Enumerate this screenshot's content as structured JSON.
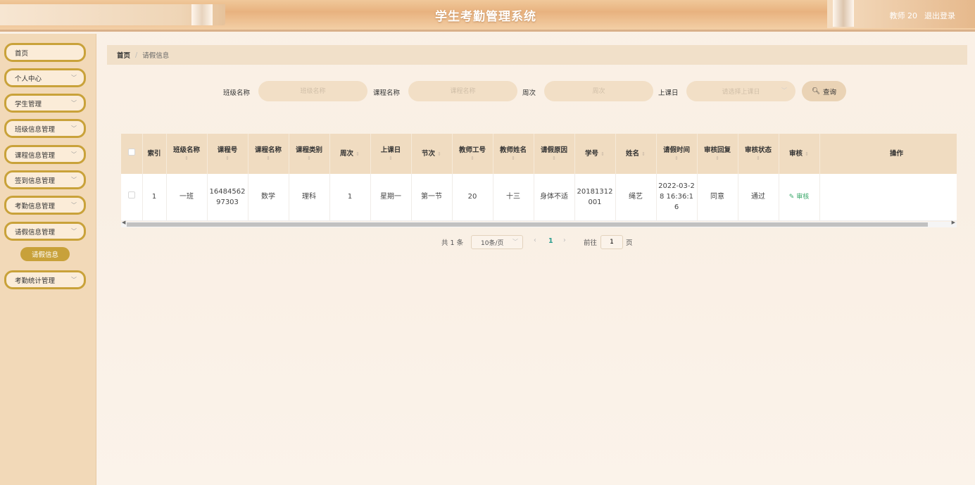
{
  "header": {
    "title": "学生考勤管理系统",
    "user": "教师 20",
    "logout": "退出登录"
  },
  "sidebar": {
    "items": [
      {
        "label": "首页"
      },
      {
        "label": "个人中心"
      },
      {
        "label": "学生管理"
      },
      {
        "label": "班级信息管理"
      },
      {
        "label": "课程信息管理"
      },
      {
        "label": "签到信息管理"
      },
      {
        "label": "考勤信息管理"
      },
      {
        "label": "请假信息管理"
      },
      {
        "label": "考勤统计管理"
      }
    ],
    "active_sub": "请假信息"
  },
  "breadcrumb": {
    "home": "首页",
    "current": "请假信息"
  },
  "search": {
    "class_label": "班级名称",
    "class_placeholder": "班级名称",
    "course_label": "课程名称",
    "course_placeholder": "课程名称",
    "week_label": "周次",
    "week_placeholder": "周次",
    "day_label": "上课日",
    "day_placeholder": "请选择上课日",
    "button": "查询"
  },
  "table": {
    "headers": [
      "索引",
      "班级名称",
      "课程号",
      "课程名称",
      "课程类别",
      "周次",
      "上课日",
      "节次",
      "教师工号",
      "教师姓名",
      "请假原因",
      "学号",
      "姓名",
      "请假时间",
      "审核回复",
      "审核状态",
      "审核",
      "操作"
    ],
    "rows": [
      [
        "1",
        "一班",
        "1648456297303",
        "数学",
        "理科",
        "1",
        "星期一",
        "第一节",
        "20",
        "十三",
        "身体不适",
        "20181312001",
        "绳艺",
        "2022-03-28 16:36:16",
        "同意",
        "通过",
        "审核",
        ""
      ]
    ]
  },
  "pagination": {
    "total": "共 1 条",
    "page_size": "10条/页",
    "current": "1",
    "goto": "前往",
    "goto_value": "1",
    "unit": "页"
  }
}
